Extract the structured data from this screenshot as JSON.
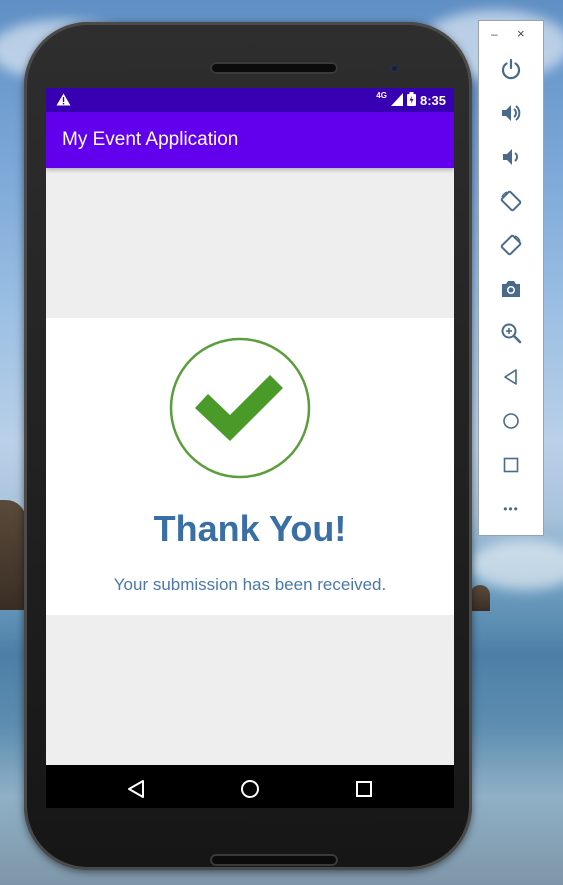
{
  "status_bar": {
    "network": "4G",
    "time": "8:35"
  },
  "app_bar": {
    "title": "My Event Application"
  },
  "confirmation": {
    "heading": "Thank You!",
    "message": "Your submission has been received."
  },
  "icons": {
    "status": [
      "warning-icon",
      "signal-icon",
      "battery-icon"
    ],
    "nav": [
      "back-icon",
      "home-icon",
      "recents-icon"
    ],
    "emulator_toolbar": [
      "power-icon",
      "volume-up-icon",
      "volume-down-icon",
      "rotate-left-icon",
      "rotate-right-icon",
      "camera-icon",
      "zoom-icon",
      "back-icon",
      "home-icon",
      "overview-icon",
      "more-icon"
    ]
  },
  "colors": {
    "status_bar": "#3700b3",
    "app_bar": "#6200ee",
    "check_green": "#4a9a2a",
    "heading_blue": "#3a6fa5",
    "toolbar_icon": "#4a6a8c"
  },
  "toolbar": {
    "minimize": "–",
    "close": "×",
    "more": "•••"
  }
}
